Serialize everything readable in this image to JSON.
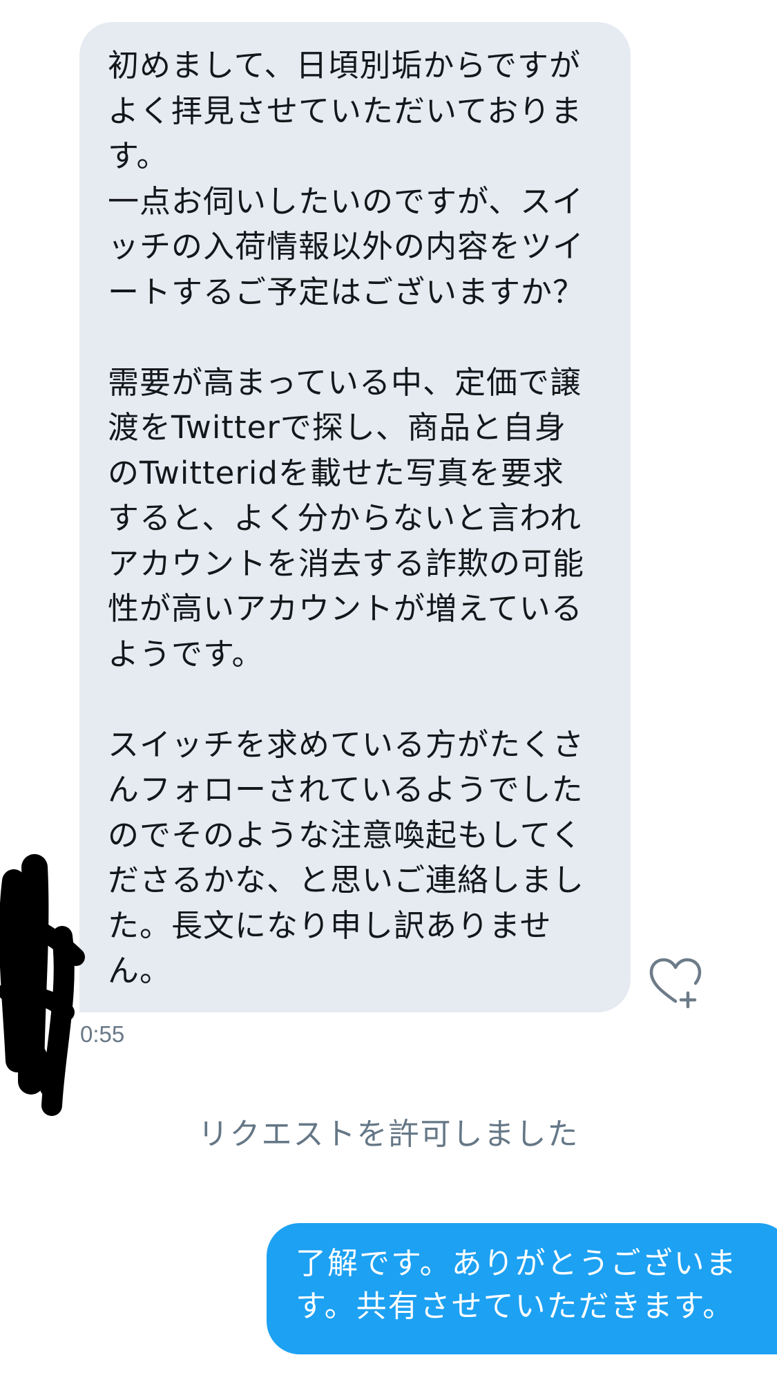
{
  "conversation": {
    "incoming_message": {
      "text": "初めまして、日頃別垢からですが\nよく拝見させていただいておりま\nす。\n一点お伺いしたいのですが、スイ\nッチの入荷情報以外の内容をツイ\nートするご予定はございますか？\n\n需要が高まっている中、定価で譲\n渡をTwitterで探し、商品と自身\nのTwitteridを載せた写真を要求\nすると、よく分からないと言われ\nアカウントを消去する詐欺の可能\n性が高いアカウントが増えている\nようです。\n\nスイッチを求めている方がたくさ\nんフォローされているようでした\nのでそのような注意喚起もしてく\nださるかな、と思いご連絡しまし\nた。長文になり申し訳ありませ\nん。",
      "timestamp": "0:55",
      "bubble_color": "#e6eaf1",
      "like_icon": "heart-plus-icon"
    },
    "system_notice": "リクエストを許可しました",
    "outgoing_message": {
      "text": "了解です。ありがとうございま\nす。共有させていただきます。",
      "bubble_color": "#1da1f2"
    }
  }
}
